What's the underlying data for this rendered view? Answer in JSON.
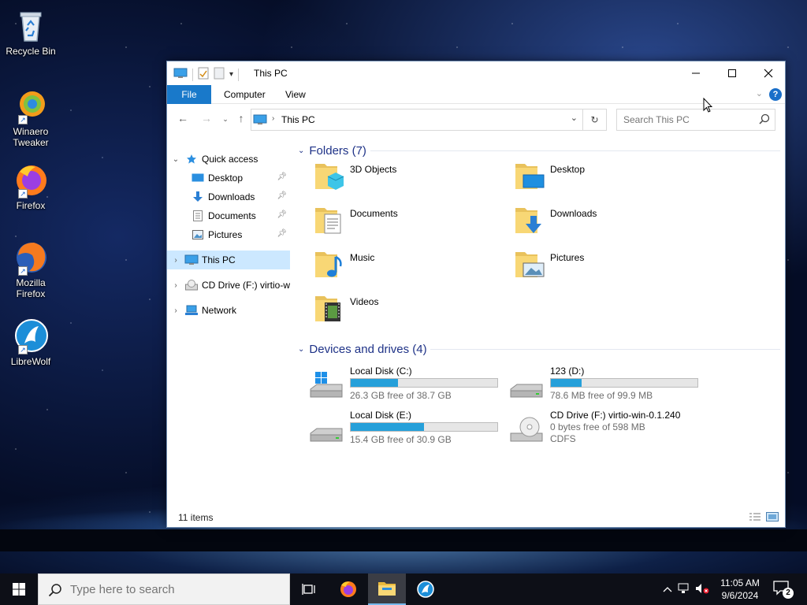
{
  "desktop": {
    "icons": [
      {
        "label": "Recycle Bin"
      },
      {
        "label": "Winaero Tweaker"
      },
      {
        "label": "Firefox"
      },
      {
        "label": "Mozilla Firefox"
      },
      {
        "label": "LibreWolf"
      }
    ]
  },
  "window": {
    "title": "This PC",
    "tabs": {
      "file": "File",
      "computer": "Computer",
      "view": "View"
    },
    "help": "?",
    "address": {
      "location": "This PC"
    },
    "search": {
      "placeholder": "Search This PC"
    },
    "nav": {
      "quick_access": "Quick access",
      "desktop": "Desktop",
      "downloads": "Downloads",
      "documents": "Documents",
      "pictures": "Pictures",
      "this_pc": "This PC",
      "cd_drive": "CD Drive (F:) virtio-w",
      "network": "Network"
    },
    "folders_header": "Folders (7)",
    "folders": [
      {
        "name": "3D Objects"
      },
      {
        "name": "Desktop"
      },
      {
        "name": "Documents"
      },
      {
        "name": "Downloads"
      },
      {
        "name": "Music"
      },
      {
        "name": "Pictures"
      },
      {
        "name": "Videos"
      }
    ],
    "drives_header": "Devices and drives (4)",
    "drives": [
      {
        "name": "Local Disk (C:)",
        "free": "26.3 GB free of 38.7 GB",
        "used_fraction": 0.32
      },
      {
        "name": "123 (D:)",
        "free": "78.6 MB free of 99.9 MB",
        "used_fraction": 0.21
      },
      {
        "name": "Local Disk (E:)",
        "free": "15.4 GB free of 30.9 GB",
        "used_fraction": 0.5
      },
      {
        "name": "CD Drive (F:) virtio-win-0.1.240",
        "free": "0 bytes free of 598 MB",
        "fs": "CDFS"
      }
    ],
    "status": "11 items"
  },
  "taskbar": {
    "search_placeholder": "Type here to search",
    "time": "11:05 AM",
    "date": "9/6/2024",
    "notifications": "2"
  },
  "colors": {
    "accent": "#1979ca",
    "selection": "#cce8ff",
    "drive_bar": "#26a0da",
    "group_header": "#1e3287"
  }
}
